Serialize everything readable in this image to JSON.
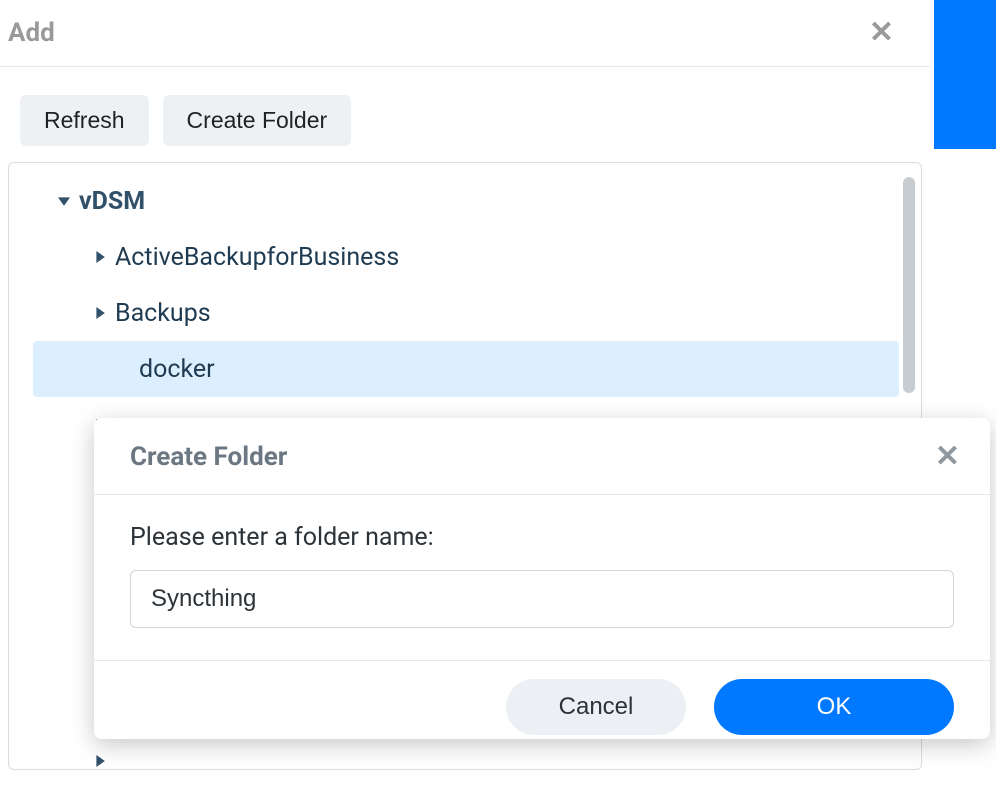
{
  "panel": {
    "title": "Add"
  },
  "toolbar": {
    "refresh_label": "Refresh",
    "create_folder_label": "Create Folder"
  },
  "tree": {
    "root_label": "vDSM",
    "items": [
      {
        "label": "ActiveBackupforBusiness",
        "expandable": true,
        "selected": false
      },
      {
        "label": "Backups",
        "expandable": true,
        "selected": false
      },
      {
        "label": "docker",
        "expandable": false,
        "selected": true
      },
      {
        "label": "",
        "expandable": true,
        "selected": false
      },
      {
        "label": "",
        "expandable": true,
        "selected": false
      },
      {
        "label": "",
        "expandable": true,
        "selected": false
      },
      {
        "label": "",
        "expandable": true,
        "selected": false
      },
      {
        "label": "",
        "expandable": true,
        "selected": false
      },
      {
        "label": "",
        "expandable": true,
        "selected": false
      },
      {
        "label": "",
        "expandable": true,
        "selected": false
      }
    ]
  },
  "modal": {
    "title": "Create Folder",
    "prompt": "Please enter a folder name:",
    "input_value": "Syncthing",
    "cancel_label": "Cancel",
    "ok_label": "OK"
  }
}
